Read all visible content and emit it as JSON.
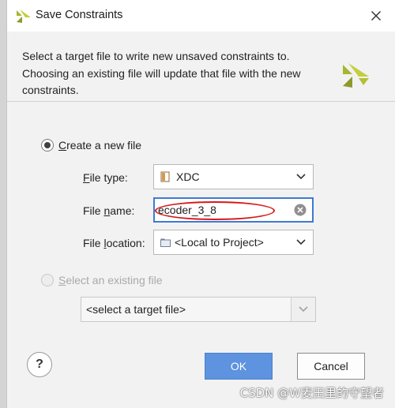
{
  "window": {
    "title": "Save Constraints",
    "close_icon": "close-icon"
  },
  "intro": {
    "line1": "Select a target file to write new unsaved constraints to.",
    "line2": "Choosing an existing file will update that file with the new",
    "line3": "constraints."
  },
  "create_new": {
    "label_first": "C",
    "label_rest": "reate a new file",
    "selected": true
  },
  "file_type": {
    "label_first": "F",
    "label_rest": "ile type:",
    "value": "XDC",
    "icon": "xdc-file-icon"
  },
  "file_name": {
    "label_first": "File ",
    "label_u": "n",
    "label_rest": "ame:",
    "value": "ecoder_3_8"
  },
  "file_location": {
    "label_first": "File ",
    "label_u": "l",
    "label_rest": "ocation:",
    "value": "<Local to Project>",
    "icon": "folder-icon"
  },
  "select_existing": {
    "label_first": "S",
    "label_rest": "elect an existing file",
    "selected": false,
    "dropdown_value": "<select a target file>"
  },
  "buttons": {
    "help": "?",
    "ok": "OK",
    "cancel": "Cancel"
  },
  "watermark": "CSDN @W麦田里的守望者",
  "colors": {
    "accent": "#5d93df",
    "focus_border": "#3d7bd4",
    "annotation": "#d81818"
  }
}
